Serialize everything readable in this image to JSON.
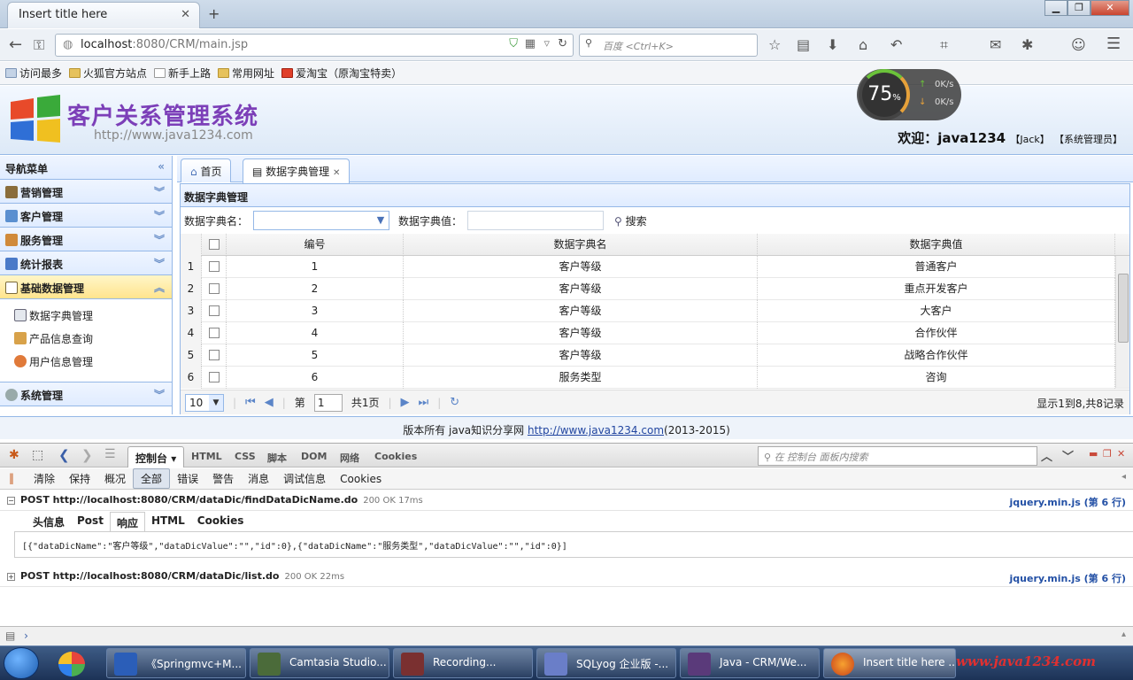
{
  "browser": {
    "tab_title": "Insert title here",
    "url_host": "localhost",
    "url_rest": ":8080/CRM/main.jsp",
    "search_placeholder": "百度 <Ctrl+K>",
    "bookmarks": [
      "访问最多",
      "火狐官方站点",
      "新手上路",
      "常用网址",
      "爱淘宝（原淘宝特卖）"
    ]
  },
  "speed_widget": {
    "percent": "75",
    "unit": "%",
    "up": "0K/s",
    "down": "0K/s"
  },
  "header": {
    "title": "客户关系管理系统",
    "url": "http://www.java1234.com",
    "welcome": "欢迎：java1234",
    "user": "【Jack】",
    "role": "【系统管理员】"
  },
  "sidebar": {
    "title": "导航菜单",
    "groups": [
      "营销管理",
      "客户管理",
      "服务管理",
      "统计报表",
      "基础数据管理",
      "系统管理"
    ],
    "subitems": [
      "数据字典管理",
      "产品信息查询",
      "用户信息管理"
    ]
  },
  "tabs": {
    "home": "首页",
    "active": "数据字典管理"
  },
  "panel": {
    "title": "数据字典管理",
    "name_label": "数据字典名：",
    "value_label": "数据字典值：",
    "search_button": "搜索"
  },
  "grid": {
    "headers": [
      "编号",
      "数据字典名",
      "数据字典值"
    ],
    "rows": [
      {
        "n": "1",
        "id": "1",
        "name": "客户等级",
        "value": "普通客户"
      },
      {
        "n": "2",
        "id": "2",
        "name": "客户等级",
        "value": "重点开发客户"
      },
      {
        "n": "3",
        "id": "3",
        "name": "客户等级",
        "value": "大客户"
      },
      {
        "n": "4",
        "id": "4",
        "name": "客户等级",
        "value": "合作伙伴"
      },
      {
        "n": "5",
        "id": "5",
        "name": "客户等级",
        "value": "战略合作伙伴"
      },
      {
        "n": "6",
        "id": "6",
        "name": "服务类型",
        "value": "咨询"
      }
    ]
  },
  "pager": {
    "size": "10",
    "page_prefix": "第",
    "page": "1",
    "page_suffix": "共1页",
    "info": "显示1到8,共8记录"
  },
  "footer": {
    "text": "版本所有 java知识分享网 ",
    "link": "http://www.java1234.com",
    "years": "(2013-2015)"
  },
  "firebug": {
    "panels": [
      "控制台",
      "HTML",
      "CSS",
      "脚本",
      "DOM",
      "网络",
      "Cookies"
    ],
    "search_placeholder": "在 控制台 面板内搜索",
    "filters": [
      "清除",
      "保持",
      "概况",
      "全部",
      "错误",
      "警告",
      "消息",
      "调试信息",
      "Cookies"
    ],
    "req1": {
      "method": "POST http://localhost:8080/CRM/dataDic/findDataDicName.do",
      "status": "200 OK 17ms",
      "source": "jquery.min.js (第 6 行)"
    },
    "subtabs": [
      "头信息",
      "Post",
      "响应",
      "HTML",
      "Cookies"
    ],
    "response": "[{\"dataDicName\":\"客户等级\",\"dataDicValue\":\"\",\"id\":0},{\"dataDicName\":\"服务类型\",\"dataDicValue\":\"\",\"id\":0}]",
    "req2": {
      "method": "POST http://localhost:8080/CRM/dataDic/list.do",
      "status": "200 OK 22ms",
      "source": "jquery.min.js (第 6 行)"
    }
  },
  "taskbar": {
    "items": [
      "《Springmvc+M...",
      "Camtasia Studio...",
      "Recording...",
      "SQLyog 企业版 -...",
      "Java - CRM/We...",
      "Insert title here ..."
    ],
    "watermark": "www.java1234.com"
  }
}
